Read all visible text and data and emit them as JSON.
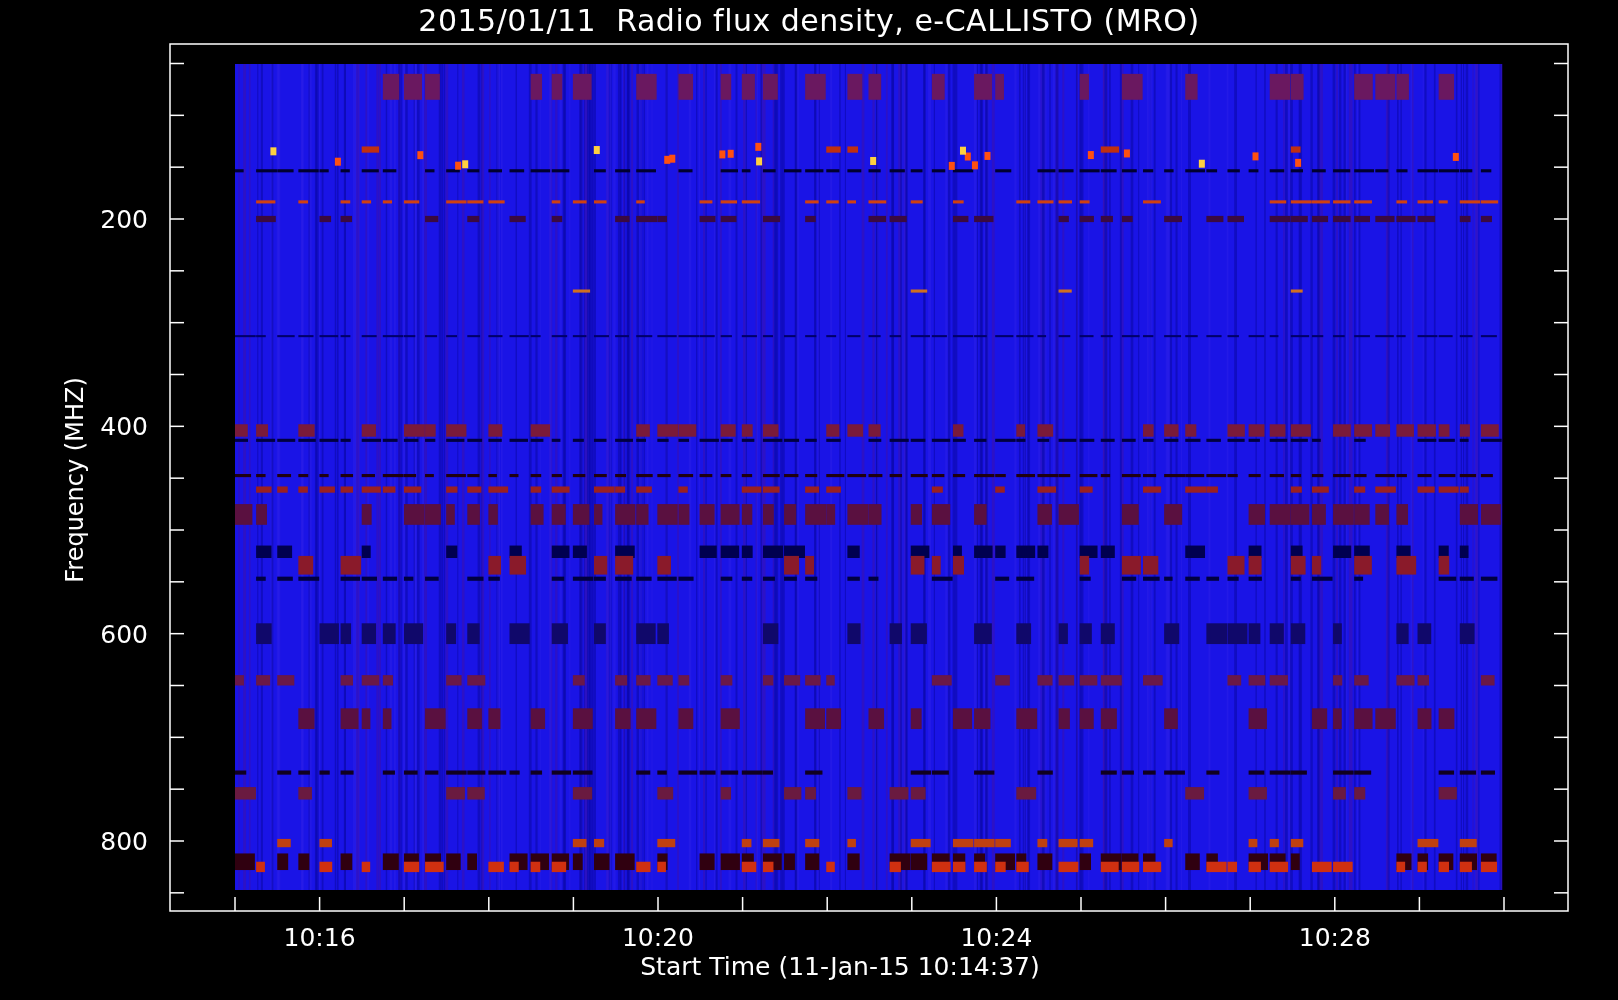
{
  "title": "2015/01/11  Radio flux density, e-CALLISTO (MRO)",
  "y_axis": {
    "label": "Frequency (MHZ)",
    "tick_labels": [
      "200",
      "400",
      "600",
      "800"
    ]
  },
  "x_axis": {
    "label": "Start Time (11-Jan-15 10:14:37)",
    "tick_labels": [
      "10:16",
      "10:20",
      "10:24",
      "10:28"
    ]
  }
}
